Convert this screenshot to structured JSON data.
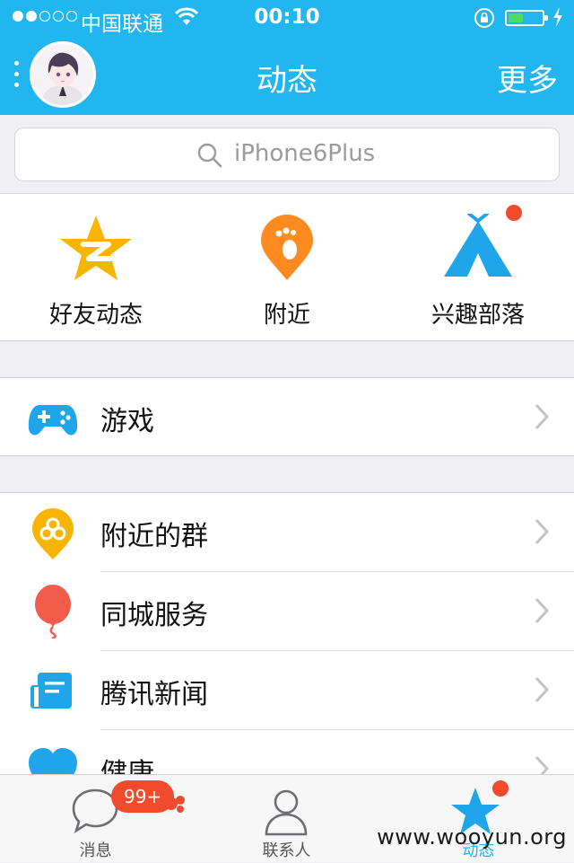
{
  "status_bar": {
    "carrier": "中国联通",
    "time": "00:10",
    "battery_level": 0.45
  },
  "nav": {
    "title": "动态",
    "right_button": "更多"
  },
  "search": {
    "placeholder": "iPhone6Plus"
  },
  "quick_entries": [
    {
      "label": "好友动态",
      "icon": "qzone-star-icon",
      "color": "#f7b500"
    },
    {
      "label": "附近",
      "icon": "footprint-pin-icon",
      "color": "#ff8a1f"
    },
    {
      "label": "兴趣部落",
      "icon": "tent-icon",
      "color": "#1fa6ea",
      "has_red_dot": true
    }
  ],
  "group1": [
    {
      "label": "游戏",
      "icon": "gamepad-icon",
      "color": "#1fa6ea"
    }
  ],
  "group2": [
    {
      "label": "附近的群",
      "icon": "group-pin-icon",
      "color": "#f7b500"
    },
    {
      "label": "同城服务",
      "icon": "balloon-icon",
      "color": "#f25c4b"
    },
    {
      "label": "腾讯新闻",
      "icon": "newspaper-icon",
      "color": "#1fa6ea"
    },
    {
      "label": "健康",
      "icon": "heart-icon",
      "color": "#1fa6ea"
    }
  ],
  "tab_bar": {
    "tabs": [
      {
        "label": "消息",
        "icon": "chat-bubble-icon",
        "badge": "99+"
      },
      {
        "label": "联系人",
        "icon": "contacts-icon"
      },
      {
        "label": "动态",
        "icon": "star-icon",
        "active": true
      }
    ]
  },
  "watermark": "www.wooyun.org",
  "colors": {
    "accent": "#21b6ef",
    "badge": "#f04b2c"
  }
}
